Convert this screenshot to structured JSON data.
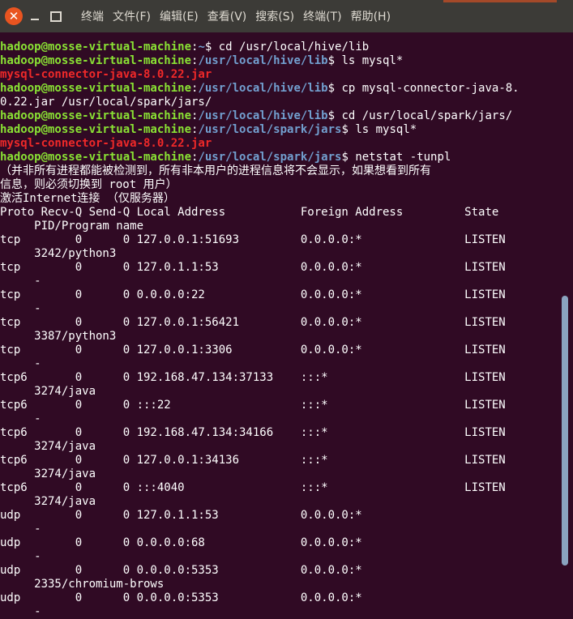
{
  "window": {
    "close_symbol": "✕",
    "menu": [
      "终端",
      "文件(F)",
      "编辑(E)",
      "查看(V)",
      "搜索(S)",
      "终端(T)",
      "帮助(H)"
    ]
  },
  "terminal": {
    "lines": [
      {
        "parts": [
          {
            "c": "u",
            "t": "hadoop@mosse-virtual-machine"
          },
          {
            "c": "t",
            "t": ":"
          },
          {
            "c": "p",
            "t": "~"
          },
          {
            "c": "t",
            "t": "$ cd /usr/local/hive/lib"
          }
        ]
      },
      {
        "parts": [
          {
            "c": "u",
            "t": "hadoop@mosse-virtual-machine"
          },
          {
            "c": "t",
            "t": ":"
          },
          {
            "c": "p",
            "t": "/usr/local/hive/lib"
          },
          {
            "c": "t",
            "t": "$ ls mysql*"
          }
        ]
      },
      {
        "parts": [
          {
            "c": "r",
            "t": "mysql-connector-java-8.0.22.jar"
          }
        ]
      },
      {
        "parts": [
          {
            "c": "u",
            "t": "hadoop@mosse-virtual-machine"
          },
          {
            "c": "t",
            "t": ":"
          },
          {
            "c": "p",
            "t": "/usr/local/hive/lib"
          },
          {
            "c": "t",
            "t": "$ cp mysql-connector-java-8."
          }
        ]
      },
      {
        "parts": [
          {
            "c": "t",
            "t": "0.22.jar /usr/local/spark/jars/"
          }
        ]
      },
      {
        "parts": [
          {
            "c": "u",
            "t": "hadoop@mosse-virtual-machine"
          },
          {
            "c": "t",
            "t": ":"
          },
          {
            "c": "p",
            "t": "/usr/local/hive/lib"
          },
          {
            "c": "t",
            "t": "$ cd /usr/local/spark/jars/"
          }
        ]
      },
      {
        "parts": [
          {
            "c": "u",
            "t": "hadoop@mosse-virtual-machine"
          },
          {
            "c": "t",
            "t": ":"
          },
          {
            "c": "p",
            "t": "/usr/local/spark/jars"
          },
          {
            "c": "t",
            "t": "$ ls mysql*"
          }
        ]
      },
      {
        "parts": [
          {
            "c": "r",
            "t": "mysql-connector-java-8.0.22.jar"
          }
        ]
      },
      {
        "parts": [
          {
            "c": "u",
            "t": "hadoop@mosse-virtual-machine"
          },
          {
            "c": "t",
            "t": ":"
          },
          {
            "c": "p",
            "t": "/usr/local/spark/jars"
          },
          {
            "c": "t",
            "t": "$ netstat -tunpl"
          }
        ]
      },
      {
        "parts": [
          {
            "c": "t",
            "t": "（并非所有进程都能被检测到，所有非本用户的进程信息将不会显示，如果想看到所有"
          }
        ]
      },
      {
        "parts": [
          {
            "c": "t",
            "t": "信息，则必须切换到 root 用户）"
          }
        ]
      },
      {
        "parts": [
          {
            "c": "t",
            "t": "激活Internet连接 （仅服务器）"
          }
        ]
      },
      {
        "parts": [
          {
            "c": "t",
            "t": "Proto Recv-Q Send-Q Local Address           Foreign Address         State"
          }
        ]
      },
      {
        "parts": [
          {
            "c": "t",
            "t": "     PID/Program name"
          }
        ]
      },
      {
        "parts": [
          {
            "c": "t",
            "t": "tcp        0      0 127.0.0.1:51693         0.0.0.0:*               LISTEN"
          }
        ]
      },
      {
        "parts": [
          {
            "c": "t",
            "t": "     3242/python3"
          }
        ]
      },
      {
        "parts": [
          {
            "c": "t",
            "t": "tcp        0      0 127.0.1.1:53            0.0.0.0:*               LISTEN"
          }
        ]
      },
      {
        "parts": [
          {
            "c": "t",
            "t": "     -"
          }
        ]
      },
      {
        "parts": [
          {
            "c": "t",
            "t": "tcp        0      0 0.0.0.0:22              0.0.0.0:*               LISTEN"
          }
        ]
      },
      {
        "parts": [
          {
            "c": "t",
            "t": "     -"
          }
        ]
      },
      {
        "parts": [
          {
            "c": "t",
            "t": "tcp        0      0 127.0.0.1:56421         0.0.0.0:*               LISTEN"
          }
        ]
      },
      {
        "parts": [
          {
            "c": "t",
            "t": "     3387/python3"
          }
        ]
      },
      {
        "parts": [
          {
            "c": "t",
            "t": "tcp        0      0 127.0.0.1:3306          0.0.0.0:*               LISTEN"
          }
        ]
      },
      {
        "parts": [
          {
            "c": "t",
            "t": "     -"
          }
        ]
      },
      {
        "parts": [
          {
            "c": "t",
            "t": "tcp6       0      0 192.168.47.134:37133    :::*                    LISTEN"
          }
        ]
      },
      {
        "parts": [
          {
            "c": "t",
            "t": "     3274/java"
          }
        ]
      },
      {
        "parts": [
          {
            "c": "t",
            "t": "tcp6       0      0 :::22                   :::*                    LISTEN"
          }
        ]
      },
      {
        "parts": [
          {
            "c": "t",
            "t": "     -"
          }
        ]
      },
      {
        "parts": [
          {
            "c": "t",
            "t": "tcp6       0      0 192.168.47.134:34166    :::*                    LISTEN"
          }
        ]
      },
      {
        "parts": [
          {
            "c": "t",
            "t": "     3274/java"
          }
        ]
      },
      {
        "parts": [
          {
            "c": "t",
            "t": "tcp6       0      0 127.0.0.1:34136         :::*                    LISTEN"
          }
        ]
      },
      {
        "parts": [
          {
            "c": "t",
            "t": "     3274/java"
          }
        ]
      },
      {
        "parts": [
          {
            "c": "t",
            "t": "tcp6       0      0 :::4040                 :::*                    LISTEN"
          }
        ]
      },
      {
        "parts": [
          {
            "c": "t",
            "t": "     3274/java"
          }
        ]
      },
      {
        "parts": [
          {
            "c": "t",
            "t": "udp        0      0 127.0.1.1:53            0.0.0.0:*"
          }
        ]
      },
      {
        "parts": [
          {
            "c": "t",
            "t": "     -"
          }
        ]
      },
      {
        "parts": [
          {
            "c": "t",
            "t": "udp        0      0 0.0.0.0:68              0.0.0.0:*"
          }
        ]
      },
      {
        "parts": [
          {
            "c": "t",
            "t": "     -"
          }
        ]
      },
      {
        "parts": [
          {
            "c": "t",
            "t": "udp        0      0 0.0.0.0:5353            0.0.0.0:*"
          }
        ]
      },
      {
        "parts": [
          {
            "c": "t",
            "t": "     2335/chromium-brows"
          }
        ]
      },
      {
        "parts": [
          {
            "c": "t",
            "t": "udp        0      0 0.0.0.0:5353            0.0.0.0:*"
          }
        ]
      },
      {
        "parts": [
          {
            "c": "t",
            "t": "     -"
          }
        ]
      }
    ]
  }
}
